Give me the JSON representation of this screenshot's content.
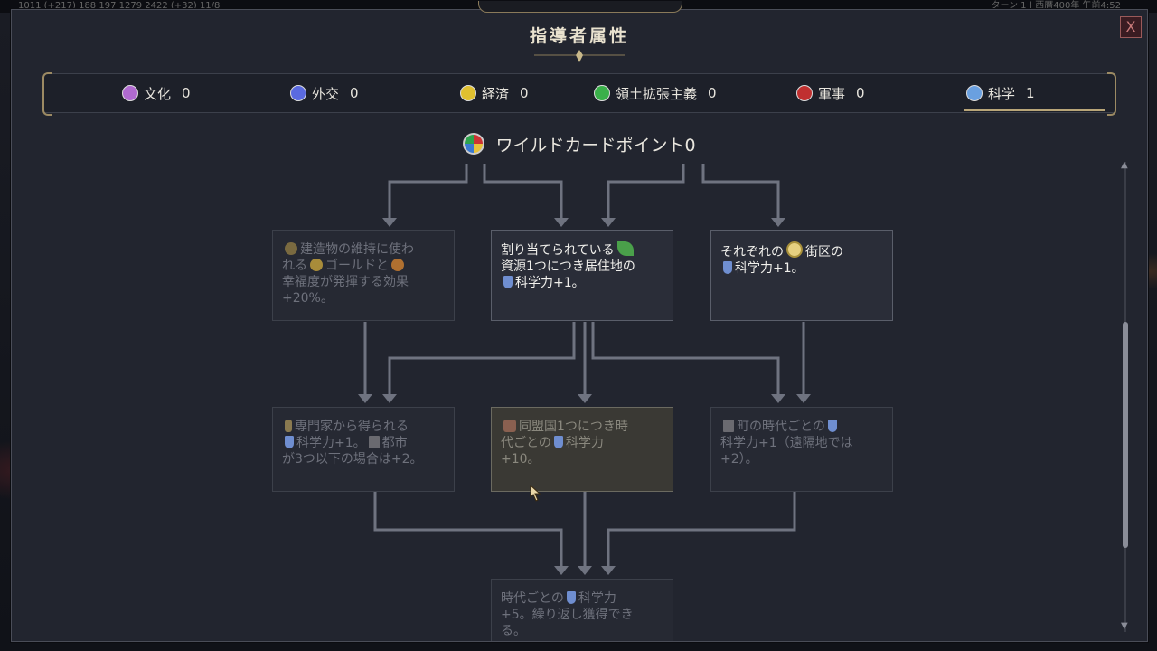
{
  "topbar": {
    "left": "1011 (+217)  188  197  1279  2422 (+32)  11/8",
    "right": "ターン 1 | 西暦400年  午前4:52"
  },
  "dialog": {
    "title": "指導者属性",
    "close_label": "X"
  },
  "tabs": [
    {
      "label": "文化",
      "value": "0",
      "icon": "culture-icon",
      "color": "#b06ad0"
    },
    {
      "label": "外交",
      "value": "0",
      "icon": "diplomacy-icon",
      "color": "#5a6ae0"
    },
    {
      "label": "経済",
      "value": "0",
      "icon": "economy-icon",
      "color": "#e0c030"
    },
    {
      "label": "領土拡張主義",
      "value": "0",
      "icon": "expansion-icon",
      "color": "#3ab04a"
    },
    {
      "label": "軍事",
      "value": "0",
      "icon": "military-icon",
      "color": "#c03030"
    },
    {
      "label": "科学",
      "value": "1",
      "icon": "science-icon",
      "color": "#6aa0e0"
    }
  ],
  "wildcard": {
    "label": "ワイルドカードポイント0"
  },
  "cards": {
    "c1": {
      "line1": "建造物の維持に使わ",
      "line2a": "れる",
      "line2b": "ゴールドと",
      "line3": "幸福度が発揮する効果",
      "line4": "+20%。"
    },
    "c2": {
      "line1": "割り当てられている",
      "line2": "資源1つにつき居住地の",
      "line3": "科学力+1。"
    },
    "c3": {
      "line1a": "それぞれの",
      "line1b": "街区の",
      "line2": "科学力+1。"
    },
    "c4": {
      "line1": "専門家から得られる",
      "line2a": "科学力+1。",
      "line2b": "都市",
      "line3": "が3つ以下の場合は+2。"
    },
    "c5": {
      "line1": "同盟国1つにつき時",
      "line2a": "代ごとの",
      "line2b": "科学力",
      "line3": "+10。"
    },
    "c6": {
      "line1": "町の時代ごとの",
      "line2": "科学力+1（遠隔地では",
      "line3": "+2）。"
    },
    "c7": {
      "line1a": "時代ごとの",
      "line1b": "科学力",
      "line2": "+5。繰り返し獲得でき",
      "line3": "る。"
    }
  }
}
